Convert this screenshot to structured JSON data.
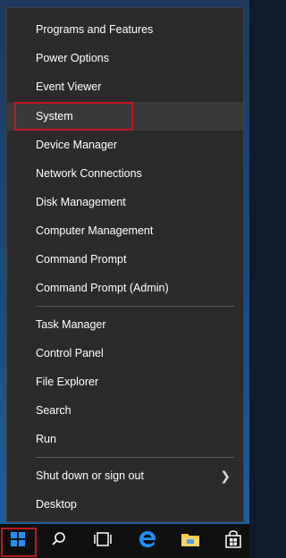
{
  "menu": {
    "items": [
      {
        "label": "Programs and Features"
      },
      {
        "label": "Power Options"
      },
      {
        "label": "Event Viewer"
      },
      {
        "label": "System"
      },
      {
        "label": "Device Manager"
      },
      {
        "label": "Network Connections"
      },
      {
        "label": "Disk Management"
      },
      {
        "label": "Computer Management"
      },
      {
        "label": "Command Prompt"
      },
      {
        "label": "Command Prompt (Admin)"
      },
      {
        "label": "Task Manager"
      },
      {
        "label": "Control Panel"
      },
      {
        "label": "File Explorer"
      },
      {
        "label": "Search"
      },
      {
        "label": "Run"
      },
      {
        "label": "Shut down or sign out"
      },
      {
        "label": "Desktop"
      }
    ]
  },
  "taskbar": {
    "buttons": [
      {
        "icon": "windows-start-icon"
      },
      {
        "icon": "search-icon"
      },
      {
        "icon": "task-view-icon"
      },
      {
        "icon": "edge-icon"
      },
      {
        "icon": "file-explorer-icon"
      },
      {
        "icon": "store-icon"
      }
    ]
  },
  "colors": {
    "menu_bg": "#2b2b2b",
    "hover_bg": "#3a3a3a",
    "highlight_border": "#c0181e",
    "taskbar_bg": "#101010",
    "accent_blue": "#1e90ff"
  }
}
